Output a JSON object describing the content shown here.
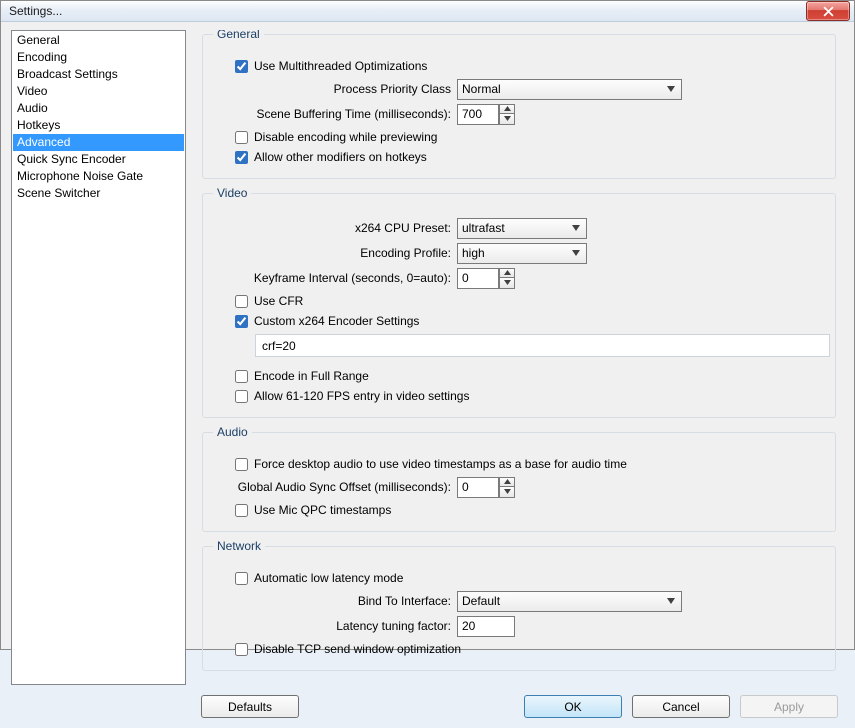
{
  "window": {
    "title": "Settings..."
  },
  "sidebar": {
    "items": [
      {
        "label": "General"
      },
      {
        "label": "Encoding"
      },
      {
        "label": "Broadcast Settings"
      },
      {
        "label": "Video"
      },
      {
        "label": "Audio"
      },
      {
        "label": "Hotkeys"
      },
      {
        "label": "Advanced",
        "selected": true
      },
      {
        "label": "Quick Sync Encoder"
      },
      {
        "label": "Microphone Noise Gate"
      },
      {
        "label": "Scene Switcher"
      }
    ]
  },
  "groups": {
    "general": {
      "title": "General",
      "multithreaded": {
        "label": "Use Multithreaded Optimizations",
        "checked": true
      },
      "priority_label": "Process Priority Class",
      "priority_value": "Normal",
      "buffering_label": "Scene Buffering Time (milliseconds):",
      "buffering_value": "700",
      "disable_preview_enc": {
        "label": "Disable encoding while previewing",
        "checked": false
      },
      "allow_modifiers": {
        "label": "Allow other modifiers on hotkeys",
        "checked": true
      }
    },
    "video": {
      "title": "Video",
      "preset_label": "x264 CPU Preset:",
      "preset_value": "ultrafast",
      "profile_label": "Encoding Profile:",
      "profile_value": "high",
      "keyframe_label": "Keyframe Interval (seconds, 0=auto):",
      "keyframe_value": "0",
      "use_cfr": {
        "label": "Use CFR",
        "checked": false
      },
      "custom_x264": {
        "label": "Custom x264 Encoder Settings",
        "checked": true
      },
      "custom_x264_value": "crf=20",
      "full_range": {
        "label": "Encode in Full Range",
        "checked": false
      },
      "allow_fps": {
        "label": "Allow 61-120 FPS entry in video settings",
        "checked": false
      }
    },
    "audio": {
      "title": "Audio",
      "force_ts": {
        "label": "Force desktop audio to use video timestamps as a base for audio time",
        "checked": false
      },
      "sync_label": "Global Audio Sync Offset (milliseconds):",
      "sync_value": "0",
      "qpc": {
        "label": "Use Mic QPC timestamps",
        "checked": false
      }
    },
    "network": {
      "title": "Network",
      "auto_lowlat": {
        "label": "Automatic low latency mode",
        "checked": false
      },
      "bind_label": "Bind To Interface:",
      "bind_value": "Default",
      "latency_label": "Latency tuning factor:",
      "latency_value": "20",
      "disable_tcp": {
        "label": "Disable TCP send window optimization",
        "checked": false
      }
    }
  },
  "buttons": {
    "defaults": "Defaults",
    "ok": "OK",
    "cancel": "Cancel",
    "apply": "Apply"
  }
}
